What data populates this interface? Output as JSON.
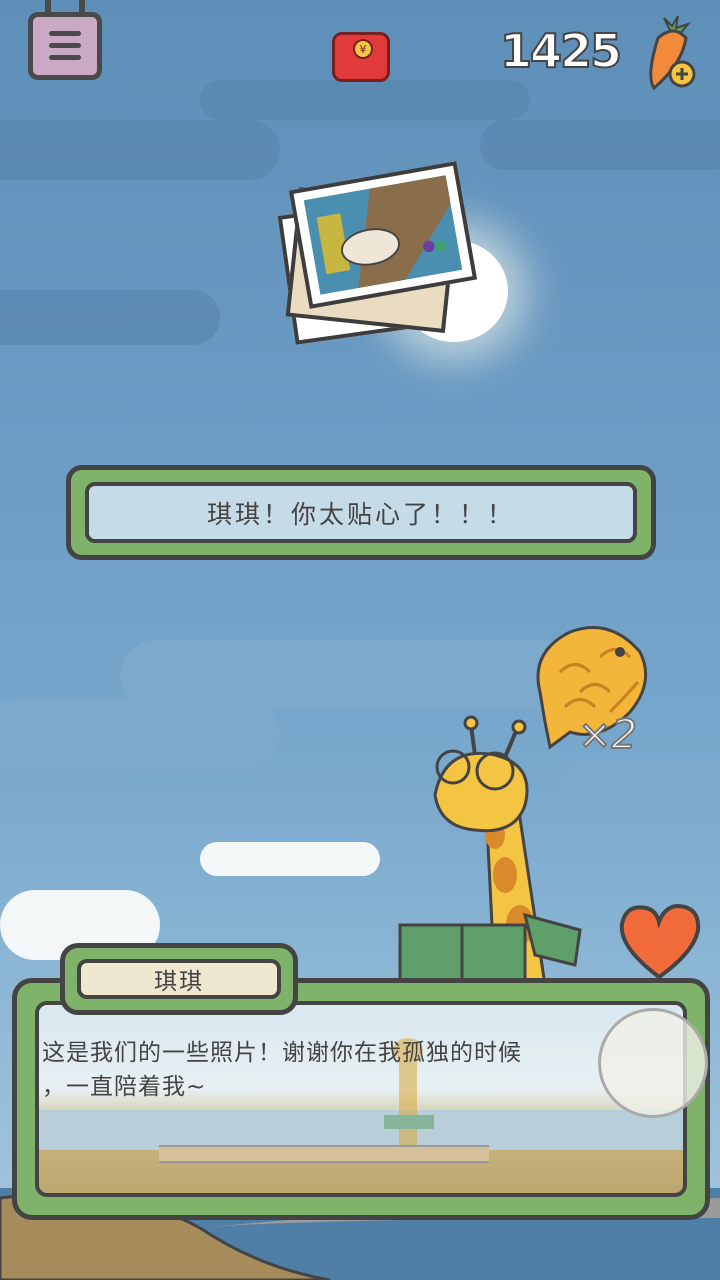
{
  "hud": {
    "carrot_count": "1425",
    "menu_icon": "menu-icon",
    "red_packet_icon": "red-packet-icon",
    "red_packet_symbol": "¥",
    "carrot_icon": "carrot-plus-icon"
  },
  "reward": {
    "item_icon": "taiyaki-fish-cake-icon",
    "multiplier": "×2",
    "photos_icon": "photo-stack-icon"
  },
  "banner": {
    "text": "琪琪！你太贴心了！！！"
  },
  "dialog": {
    "speaker": "琪琪",
    "line1": "这是我们的一些照片！谢谢你在我孤独的时候",
    "line2": "，一直陪着我~"
  },
  "colors": {
    "sky": "#6c9cc4",
    "panel_green": "#7fb36a",
    "outline": "#444444",
    "banner_fill": "#c6dbe8",
    "heart": "#f26b3a"
  }
}
